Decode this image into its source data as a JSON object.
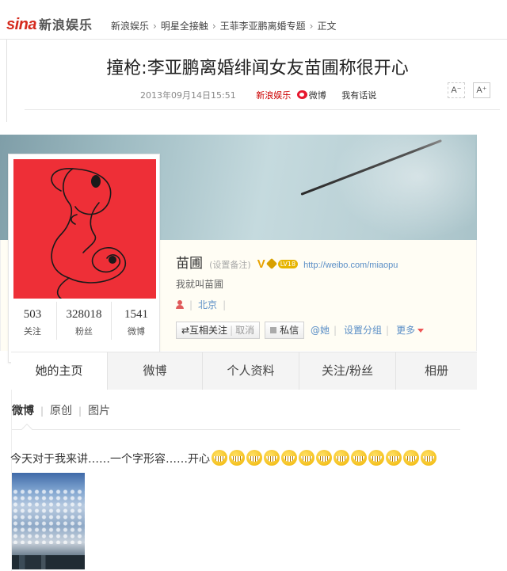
{
  "header": {
    "logo_text": "sina",
    "logo_channel": "新浪娱乐",
    "breadcrumbs": [
      "新浪娱乐",
      "明星全接触",
      "王菲李亚鹏离婚专题",
      "正文"
    ]
  },
  "article": {
    "title": "撞枪:李亚鹏离婚绯闻女友苗圃称很开心",
    "timestamp": "2013年09月14日15:51",
    "source": "新浪娱乐",
    "weibo_label": "微博",
    "comment_label": "我有话说",
    "font_smaller": "A⁻",
    "font_larger": "A⁺"
  },
  "profile": {
    "name": "苗圃",
    "remark": "(设置备注)",
    "verified_badge": "V",
    "level_badge": "LV18",
    "url": "http://weibo.com/miaopu",
    "bio": "我就叫苗圃",
    "location": "北京",
    "stats": [
      {
        "value": "503",
        "label": "关注"
      },
      {
        "value": "328018",
        "label": "粉丝"
      },
      {
        "value": "1541",
        "label": "微博"
      }
    ],
    "actions": {
      "mutual": "⇄互相关注",
      "cancel": "取消",
      "message": "私信",
      "at_her": "@她",
      "group": "设置分组",
      "more": "更多"
    }
  },
  "tabs": [
    "她的主页",
    "微博",
    "个人资料",
    "关注/粉丝",
    "相册"
  ],
  "feed": {
    "subtabs": [
      "微博",
      "原创",
      "图片"
    ],
    "post_text": "今天对于我来讲……一个字形容……开心",
    "emoticon_count": 13,
    "emoticon_icon": "laughing-emoji-icon"
  },
  "colors": {
    "sina_red": "#d52b1e",
    "link_blue": "#5a8ec6",
    "avatar_red": "#ee2f37"
  }
}
